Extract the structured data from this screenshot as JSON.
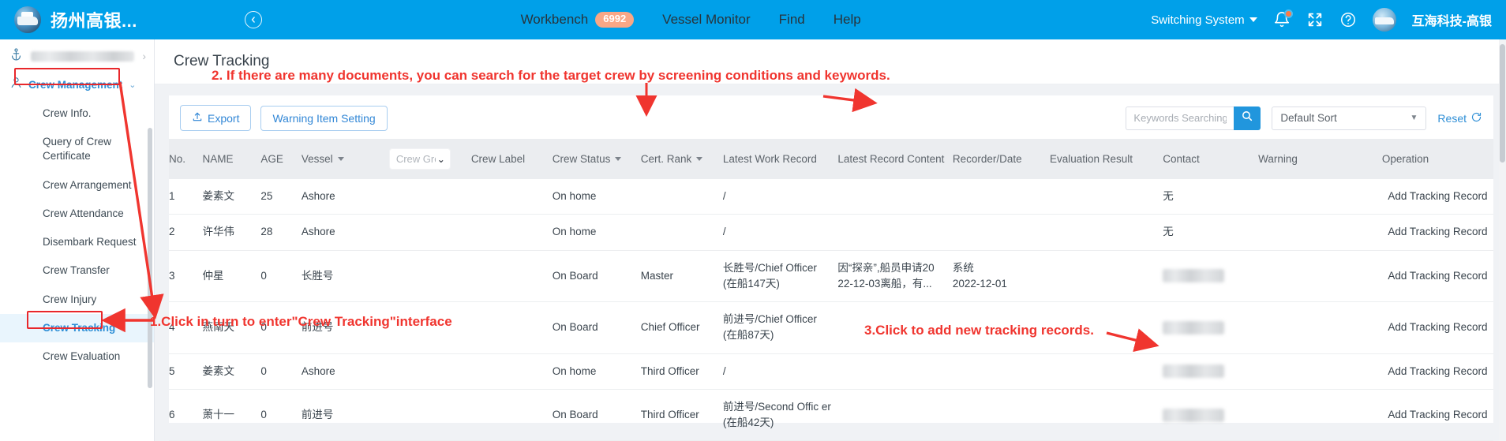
{
  "header": {
    "brand_name": "扬州高银...",
    "brand_logo_icon": "ship-logo-icon",
    "collapse_icon": "collapse-left-icon",
    "nav": [
      {
        "label": "Workbench",
        "badge": "6992"
      },
      {
        "label": "Vessel Monitor",
        "badge": ""
      },
      {
        "label": "Find",
        "badge": ""
      },
      {
        "label": "Help",
        "badge": ""
      }
    ],
    "switching_system": "Switching System",
    "bell_icon": "bell-icon",
    "fullscreen_icon": "fullscreen-icon",
    "help_icon": "help-circle-icon",
    "avatar_icon": "user-avatar-icon",
    "user_name": "互海科技-高银"
  },
  "sidebar": {
    "vessel_selector": {
      "icon": "anchor-icon",
      "value": "",
      "chevron": "›"
    },
    "group": {
      "icon": "person-icon",
      "label": "Crew Management",
      "chevron": "⌄"
    },
    "items": [
      {
        "label": "Crew Info."
      },
      {
        "label": "Query of Crew Certificate"
      },
      {
        "label": "Crew Arrangement"
      },
      {
        "label": "Crew Attendance"
      },
      {
        "label": "Disembark Request"
      },
      {
        "label": "Crew Transfer"
      },
      {
        "label": "Crew Injury"
      },
      {
        "label": "Crew Tracking"
      },
      {
        "label": "Crew Evaluation"
      }
    ],
    "active_item": "Crew Tracking"
  },
  "main": {
    "page_title": "Crew Tracking",
    "toolbar": {
      "export_label": "Export",
      "export_icon": "upload-icon",
      "warning_setting_label": "Warning Item Setting",
      "search_placeholder": "Keywords Searching",
      "search_value": "",
      "search_icon": "search-icon",
      "sort_value": "Default Sort",
      "sort_caret_icon": "chevron-down-icon",
      "reset_label": "Reset",
      "reset_icon": "refresh-icon"
    },
    "table": {
      "columns": [
        {
          "label": "No.",
          "sortable": false
        },
        {
          "label": "NAME",
          "sortable": false
        },
        {
          "label": "AGE",
          "sortable": false
        },
        {
          "label": "Vessel",
          "sortable": true
        },
        {
          "label": "Crew Grou",
          "filter_select": true
        },
        {
          "label": "Crew Label",
          "sortable": false
        },
        {
          "label": "Crew Status",
          "sortable": true
        },
        {
          "label": "Cert. Rank",
          "sortable": true
        },
        {
          "label": "Latest Work Record",
          "sortable": false
        },
        {
          "label": "Latest Record Content",
          "sortable": false
        },
        {
          "label": "Recorder/Date",
          "sortable": false
        },
        {
          "label": "Evaluation Result",
          "sortable": false
        },
        {
          "label": "Contact",
          "sortable": false
        },
        {
          "label": "Warning",
          "sortable": false
        },
        {
          "label": "Operation",
          "sortable": false
        }
      ],
      "rows": [
        {
          "no": "1",
          "name": "姜素文",
          "age": "25",
          "vessel": "Ashore",
          "crew_group": "",
          "crew_label": "",
          "crew_status": "On home",
          "cert_rank": "",
          "latest_work_record": "/",
          "latest_work_record_sub": "",
          "latest_record_content": "",
          "recorder": "",
          "date": "",
          "evaluation_result": "",
          "contact": "无",
          "contact_blurred": false,
          "warning": "",
          "operation": "Add Tracking Record"
        },
        {
          "no": "2",
          "name": "许华伟",
          "age": "28",
          "vessel": "Ashore",
          "crew_group": "",
          "crew_label": "",
          "crew_status": "On home",
          "cert_rank": "",
          "latest_work_record": "/",
          "latest_work_record_sub": "",
          "latest_record_content": "",
          "recorder": "",
          "date": "",
          "evaluation_result": "",
          "contact": "无",
          "contact_blurred": false,
          "warning": "",
          "operation": "Add Tracking Record"
        },
        {
          "no": "3",
          "name": "仲星",
          "age": "0",
          "vessel": "长胜号",
          "crew_group": "",
          "crew_label": "",
          "crew_status": "On Board",
          "cert_rank": "Master",
          "latest_work_record": "长胜号/Chief Officer",
          "latest_work_record_sub": "(在船147天)",
          "latest_record_content": "因“探亲”,船员申请20\n22-12-03离船，有...",
          "recorder": "系统",
          "date": "2022-12-01",
          "evaluation_result": "",
          "contact": "",
          "contact_blurred": true,
          "warning": "",
          "operation": "Add Tracking Record"
        },
        {
          "no": "4",
          "name": "燕南天",
          "age": "0",
          "vessel": "前进号",
          "crew_group": "",
          "crew_label": "",
          "crew_status": "On Board",
          "cert_rank": "Chief Officer",
          "latest_work_record": "前进号/Chief Officer",
          "latest_work_record_sub": "(在船87天)",
          "latest_record_content": "",
          "recorder": "",
          "date": "",
          "evaluation_result": "",
          "contact": "",
          "contact_blurred": true,
          "warning": "",
          "operation": "Add Tracking Record"
        },
        {
          "no": "5",
          "name": "姜素文",
          "age": "0",
          "vessel": "Ashore",
          "crew_group": "",
          "crew_label": "",
          "crew_status": "On home",
          "cert_rank": "Third Officer",
          "latest_work_record": "/",
          "latest_work_record_sub": "",
          "latest_record_content": "",
          "recorder": "",
          "date": "",
          "evaluation_result": "",
          "contact": "",
          "contact_blurred": true,
          "warning": "",
          "operation": "Add Tracking Record"
        },
        {
          "no": "6",
          "name": "萧十一",
          "age": "0",
          "vessel": "前进号",
          "crew_group": "",
          "crew_label": "",
          "crew_status": "On Board",
          "cert_rank": "Third Officer",
          "latest_work_record": "前进号/Second Offic er",
          "latest_work_record_sub": "(在船42天)",
          "latest_record_content": "",
          "recorder": "",
          "date": "",
          "evaluation_result": "",
          "contact": "",
          "contact_blurred": true,
          "warning": "",
          "operation": "Add Tracking Record"
        }
      ]
    }
  },
  "annotations": [
    {
      "id": "step2",
      "text": "2. If there are many documents, you can search for the target crew by screening conditions and keywords."
    },
    {
      "id": "step1",
      "text": "1.Click in turn to enter\"Crew Tracking\"interface"
    },
    {
      "id": "step3",
      "text": "3.Click to add new tracking records."
    }
  ]
}
